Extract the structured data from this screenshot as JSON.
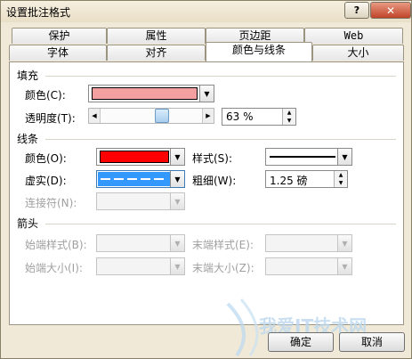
{
  "window": {
    "title": "设置批注格式",
    "help_label": "?",
    "close_label": "✕"
  },
  "tabs_row1": [
    "保护",
    "属性",
    "页边距",
    "Web"
  ],
  "tabs_row2": [
    "字体",
    "对齐",
    "颜色与线条",
    "大小"
  ],
  "active_tab": "颜色与线条",
  "fill": {
    "section_label": "填充",
    "color_label": "颜色(C):",
    "color_value": "#f4a0a0",
    "transparency_label": "透明度(T):",
    "transparency_value": "63 %",
    "transparency_level": 0.63
  },
  "line": {
    "section_label": "线条",
    "color_label": "颜色(O):",
    "color_value": "#ff0000",
    "style_label": "样式(S):",
    "dash_label": "虚实(D):",
    "dash_color": "#3399ff",
    "weight_label": "粗细(W):",
    "weight_value": "1.25 磅",
    "connector_label": "连接符(N):"
  },
  "arrows": {
    "section_label": "箭头",
    "begin_style_label": "始端样式(B):",
    "end_style_label": "末端样式(E):",
    "begin_size_label": "始端大小(I):",
    "end_size_label": "末端大小(Z):"
  },
  "buttons": {
    "ok": "确定",
    "cancel": "取消"
  },
  "watermark": {
    "text": "我爱IT技术网"
  }
}
